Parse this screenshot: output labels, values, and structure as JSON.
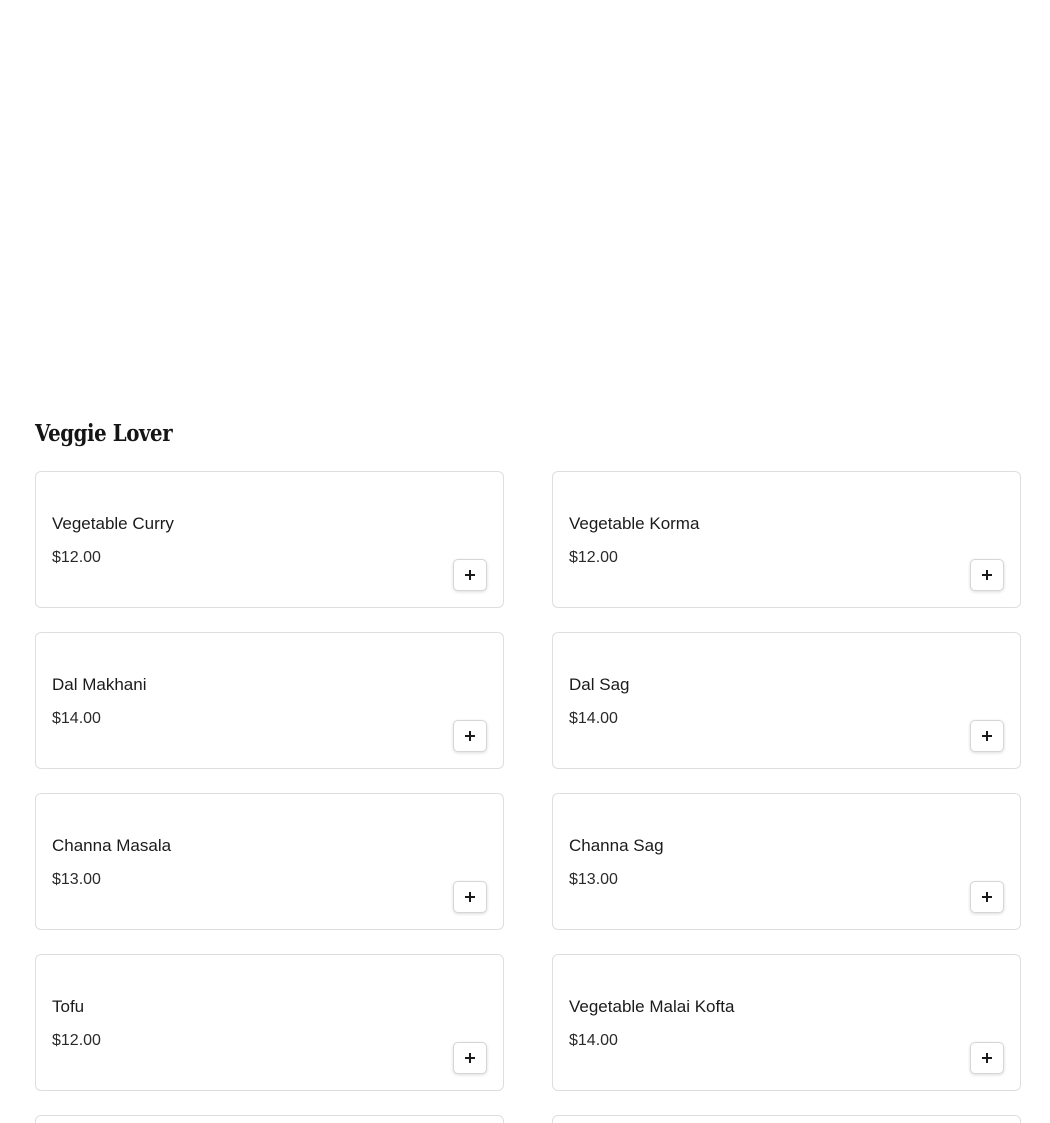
{
  "section": {
    "title": "Veggie Lover"
  },
  "items": [
    {
      "name": "Vegetable Curry",
      "price": "$12.00"
    },
    {
      "name": "Vegetable Korma",
      "price": "$12.00"
    },
    {
      "name": "Dal Makhani",
      "price": "$14.00"
    },
    {
      "name": "Dal Sag",
      "price": "$14.00"
    },
    {
      "name": "Channa Masala",
      "price": "$13.00"
    },
    {
      "name": "Channa Sag",
      "price": "$13.00"
    },
    {
      "name": "Tofu",
      "price": "$12.00"
    },
    {
      "name": "Vegetable Malai Kofta",
      "price": "$14.00"
    }
  ],
  "icons": {
    "add": "plus-icon"
  },
  "colors": {
    "background": "#ffffff",
    "card_border": "#dedede",
    "text": "#1a1a1a"
  }
}
